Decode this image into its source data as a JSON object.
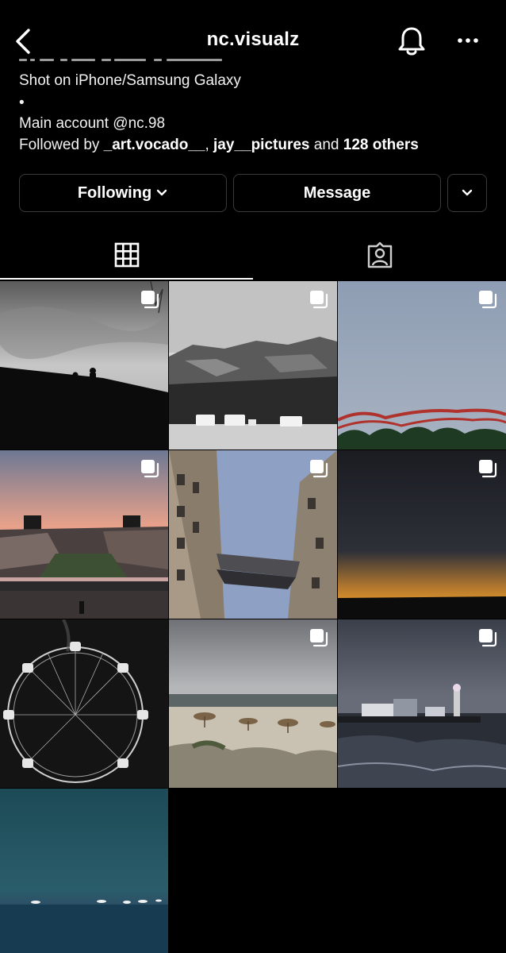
{
  "header": {
    "title": "nc.visualz",
    "back_icon": "chevron-left-icon",
    "notification_icon": "bell-icon",
    "more_icon": "more-horizontal-icon"
  },
  "bio": {
    "line1": "Shot on iPhone/Samsung Galaxy",
    "line2": "•",
    "line3": "Main account @nc.98",
    "followed_by_prefix": "Followed by ",
    "follower1": "_art.vocado__",
    "separator": ", ",
    "follower2": "jay__pictures",
    "and_text": " and ",
    "others": "128 others"
  },
  "actions": {
    "following_label": "Following",
    "message_label": "Message"
  },
  "tabs": [
    {
      "name": "posts-grid",
      "icon": "grid-icon",
      "active": true
    },
    {
      "name": "tagged",
      "icon": "tagged-person-icon",
      "active": false
    }
  ],
  "posts": [
    {
      "subject": "silhouettes-on-wall",
      "multi": true
    },
    {
      "subject": "campers-under-cliff",
      "multi": true
    },
    {
      "subject": "roller-coaster-sky",
      "multi": true
    },
    {
      "subject": "city-sunset-park",
      "multi": true
    },
    {
      "subject": "building-bridge-sky",
      "multi": true
    },
    {
      "subject": "dusk-horizon",
      "multi": true
    },
    {
      "subject": "ferris-wheel",
      "multi": false
    },
    {
      "subject": "beach-umbrellas",
      "multi": true
    },
    {
      "subject": "pier-stormy-sea",
      "multi": true
    },
    {
      "subject": "ocean-boats-teal",
      "multi": false
    }
  ],
  "colors": {
    "background": "#000000",
    "text": "#ffffff",
    "border": "#3a3a3a"
  }
}
